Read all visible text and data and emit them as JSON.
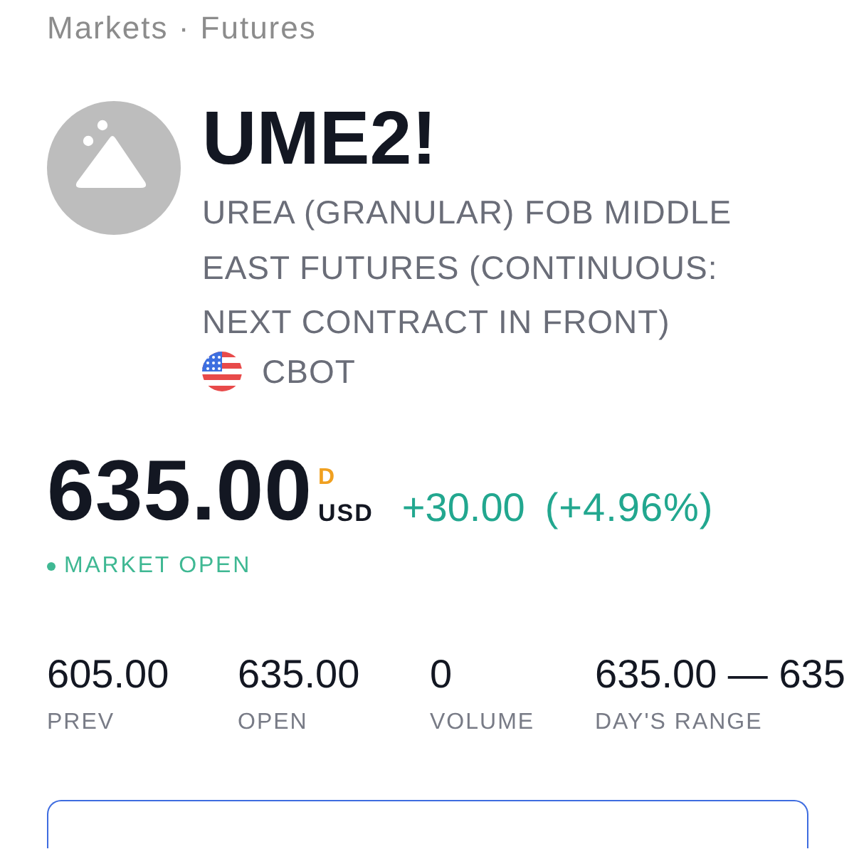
{
  "breadcrumb": "Markets · Futures",
  "symbol": {
    "ticker": "UME2!",
    "description": "UREA (GRANULAR) FOB MIDDLE EAST FUTURES (CONTINUOUS: NEXT CONTRACT IN FRONT)",
    "exchange": "CBOT"
  },
  "quote": {
    "price": "635.00",
    "data_flag": "D",
    "currency": "USD",
    "change": "+30.00",
    "change_percent": "(+4.96%)",
    "positive": true,
    "market_status": {
      "label": "MARKET OPEN",
      "open": true
    }
  },
  "stats": [
    {
      "value": "605.00",
      "label": "PREV"
    },
    {
      "value": "635.00",
      "label": "OPEN"
    },
    {
      "value": "0",
      "label": "VOLUME"
    },
    {
      "value": "635.00 — 635",
      "label": "DAY'S RANGE"
    }
  ]
}
